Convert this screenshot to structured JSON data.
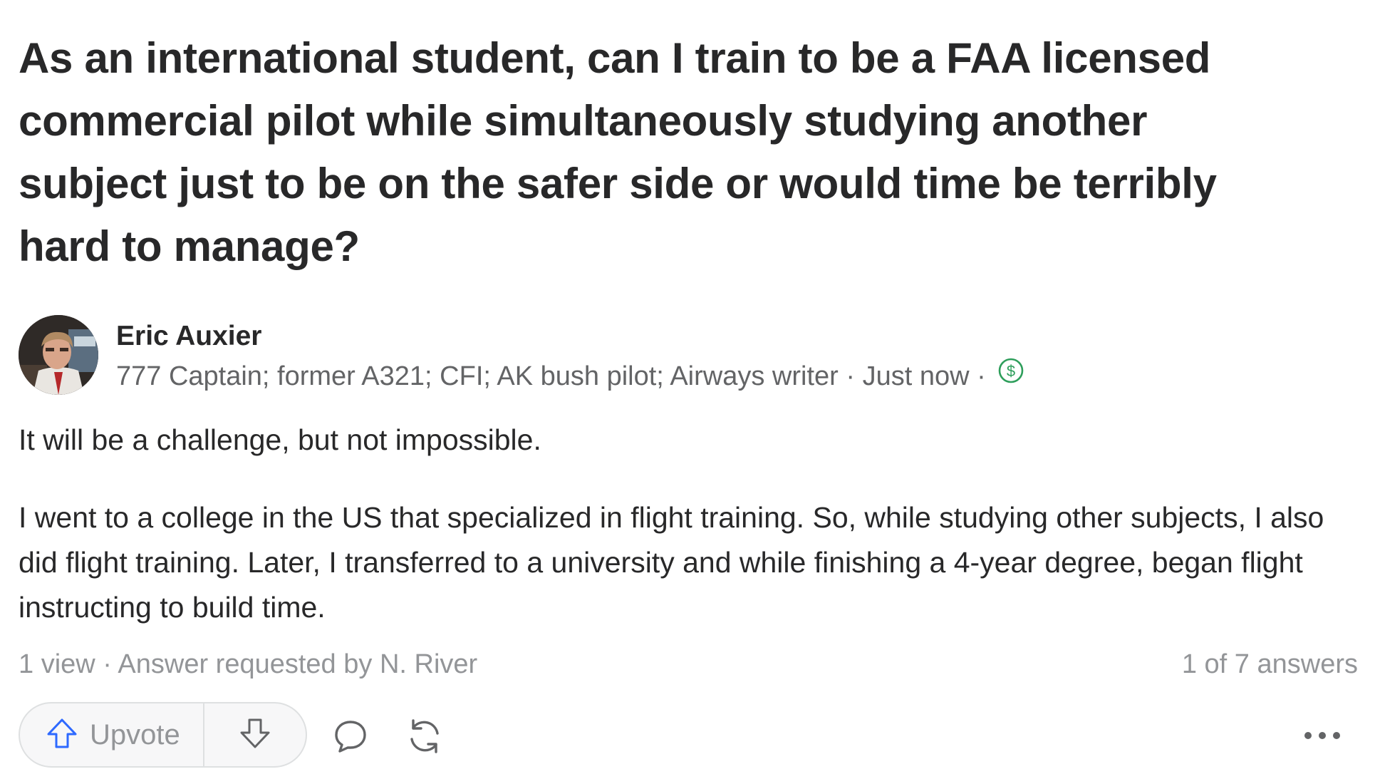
{
  "question": {
    "title": "As an international student, can I train to be a FAA licensed commercial pilot while simultaneously studying another subject just to be on the safer side or would time be terribly hard to manage?"
  },
  "author": {
    "name": "Eric Auxier",
    "credentials": "777 Captain; former A321; CFI; AK bush pilot; Airways writer",
    "separator": " · ",
    "timestamp": "Just now",
    "monetization_icon": "dollar-circle-icon"
  },
  "answer": {
    "paragraphs": [
      "It will be a challenge, but not impossible.",
      "I went to a college in the US that specialized in flight training. So, while studying other subjects, I also did flight training. Later, I transferred to a university and while finishing a 4-year degree, began flight instructing to build time."
    ]
  },
  "stats": {
    "views": "1 view",
    "separator": " · ",
    "requested_by": "Answer requested by N. River",
    "position": "1 of 7 answers"
  },
  "actions": {
    "upvote_label": "Upvote",
    "upvote_icon": "arrow-up-icon",
    "downvote_icon": "arrow-down-icon",
    "comment_icon": "comment-icon",
    "share_icon": "share-icon",
    "more_icon": "more-icon"
  },
  "colors": {
    "text_primary": "#282829",
    "text_secondary": "#636466",
    "text_muted": "#939598",
    "accent_green": "#2e9e5b",
    "border": "#dee0e1",
    "pill_bg": "#f7f7f8",
    "upvote_blue": "#2e69ff"
  }
}
